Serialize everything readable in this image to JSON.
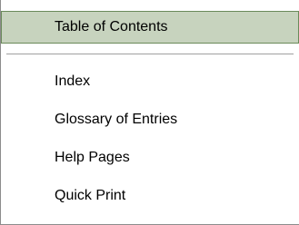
{
  "menu": {
    "items": [
      {
        "label": "Table of Contents",
        "selected": true
      },
      {
        "label": "Index",
        "selected": false
      },
      {
        "label": "Glossary of Entries",
        "selected": false
      },
      {
        "label": "Help Pages",
        "selected": false
      },
      {
        "label": "Quick Print",
        "selected": false
      }
    ]
  },
  "colors": {
    "highlight_background": "#c7d3be",
    "highlight_border": "#6a8a5a",
    "separator": "#a0a0a0",
    "frame_border": "#8c8c8c",
    "text": "#000000"
  }
}
